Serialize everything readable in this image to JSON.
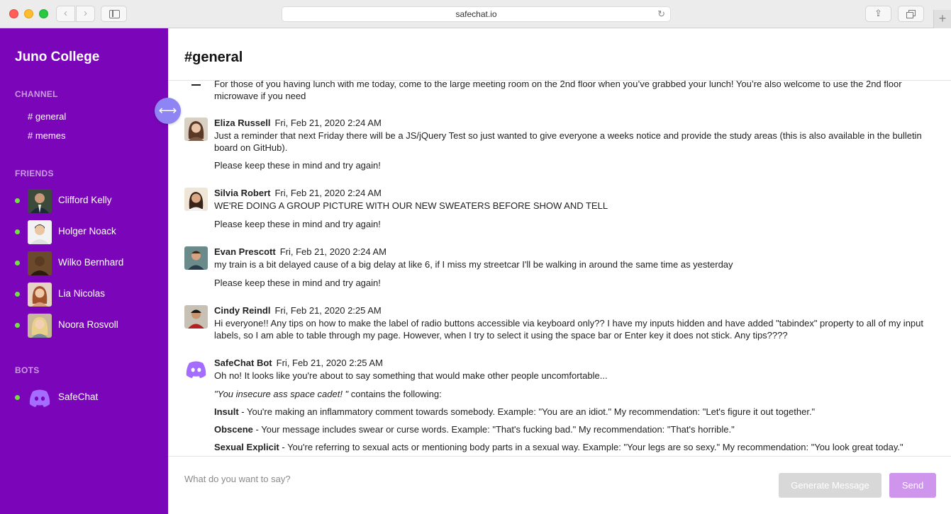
{
  "browser": {
    "url": "safechat.io",
    "back_icon": "chevron-left-icon",
    "forward_icon": "chevron-right-icon",
    "reload_glyph": "↻",
    "share_glyph": "⇪",
    "newtab_glyph": "+"
  },
  "sidebar": {
    "brand": "Juno College",
    "channel_label": "CHANNEL",
    "channels": [
      "# general",
      "# memes"
    ],
    "friends_label": "FRIENDS",
    "friends": [
      {
        "name": "Clifford Kelly",
        "status": "online"
      },
      {
        "name": "Holger Noack",
        "status": "online"
      },
      {
        "name": "Wilko Bernhard",
        "status": "online"
      },
      {
        "name": "Lia Nicolas",
        "status": "online"
      },
      {
        "name": "Noora Rosvoll",
        "status": "online"
      }
    ],
    "bots_label": "BOTS",
    "bots": [
      {
        "name": "SafeChat",
        "status": "online"
      }
    ],
    "collapse_glyph": "⟷"
  },
  "main": {
    "channel_title": "#general",
    "messages": [
      {
        "author": "",
        "time": "",
        "text": "For those of you having lunch with me today, come to the large meeting room on the 2nd floor when you’ve grabbed your lunch! You’re also welcome to use the 2nd floor microwave if you need",
        "extra": ""
      },
      {
        "author": "Eliza Russell",
        "time": "Fri, Feb 21, 2020 2:24 AM",
        "text": "Just a reminder that next Friday there will be a JS/jQuery Test so just wanted to give everyone a weeks notice and provide the study areas (this is also available in the bulletin board on GitHub).",
        "extra": "Please keep these in mind and try again!"
      },
      {
        "author": "Silvia Robert",
        "time": "Fri, Feb 21, 2020 2:24 AM",
        "text": "WE'RE DOING A GROUP PICTURE WITH OUR NEW SWEATERS BEFORE SHOW AND TELL",
        "extra": "Please keep these in mind and try again!"
      },
      {
        "author": "Evan Prescott",
        "time": "Fri, Feb 21, 2020 2:24 AM",
        "text": "my train is a bit delayed cause of a big delay at like 6, if I miss my streetcar I'll be walking in around the same time as yesterday",
        "extra": "Please keep these in mind and try again!"
      },
      {
        "author": "Cindy Reindl",
        "time": "Fri, Feb 21, 2020 2:25 AM",
        "text": "Hi everyone!! Any tips on how to make the label of radio buttons accessible via keyboard only?? I have my inputs hidden and have added \"tabindex\" property to all of my input labels, so I am able to table through my page. However, when I try to select it using the space bar or Enter key it does not stick. Any tips????",
        "extra": ""
      }
    ],
    "bot_message": {
      "author": "SafeChat Bot",
      "time": "Fri, Feb 21, 2020 2:25 AM",
      "intro": "Oh no! It looks like you're about to say something that would make other people uncomfortable...",
      "quote": "\"You insecure ass space cadet! \"",
      "quote_suffix": " contains the following:",
      "categories": [
        {
          "name": "Insult",
          "desc": " - You're making an inflammatory comment towards somebody. Example: \"You are an idiot.\" My recommendation: \"Let's figure it out together.\""
        },
        {
          "name": "Obscene",
          "desc": " - Your message includes swear or curse words. Example: \"That's fucking bad.\" My recommendation: \"That's horrible.\""
        },
        {
          "name": "Sexual Explicit",
          "desc": " - You're referring to sexual acts or mentioning body parts in a sexual way. Example: \"Your legs are so sexy.\" My recommendation: \"You look great today.\""
        }
      ]
    }
  },
  "composer": {
    "placeholder": "What do you want to say?",
    "value": "",
    "generate_label": "Generate Message",
    "send_label": "Send"
  },
  "colors": {
    "sidebar_bg": "#7b06b9",
    "online_dot": "#6ee43b",
    "collapse_button": "#8f84f4",
    "send_button": "#cf95ec",
    "generate_button": "#d8d8d8"
  }
}
